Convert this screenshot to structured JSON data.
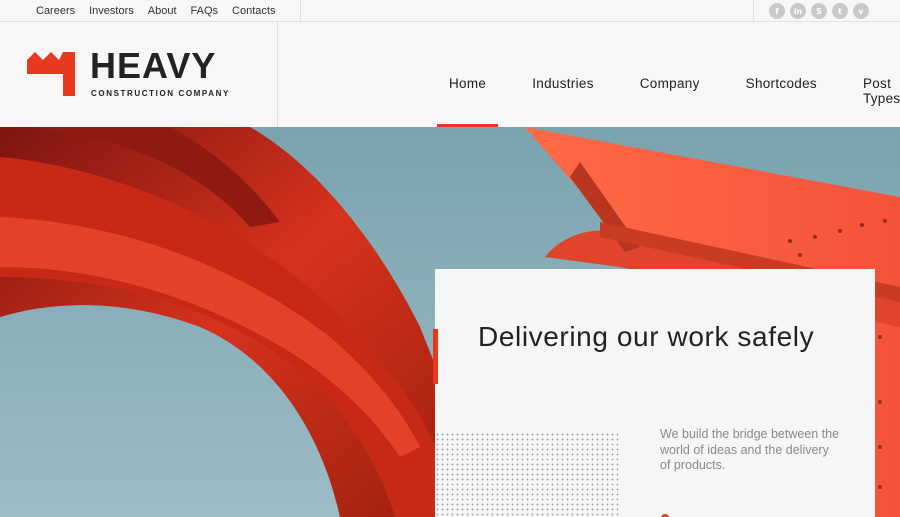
{
  "topbar": {
    "links": [
      "Careers",
      "Investors",
      "About",
      "FAQs",
      "Contacts"
    ],
    "social_icons": [
      "facebook-icon",
      "linkedin-icon",
      "skype-icon",
      "twitter-icon",
      "vimeo-icon"
    ],
    "social_glyphs": [
      "f",
      "in",
      "S",
      "t",
      "v"
    ]
  },
  "brand": {
    "name": "HEAVY",
    "tagline": "CONSTRUCTION COMPANY",
    "accent_color": "#e8381f"
  },
  "nav": {
    "items": [
      "Home",
      "Industries",
      "Company",
      "Shortcodes",
      "Post Types"
    ],
    "active": "Home"
  },
  "hero": {
    "title": "Delivering our work safely",
    "text": "We build the bridge between the world of ideas and the delivery of products."
  }
}
